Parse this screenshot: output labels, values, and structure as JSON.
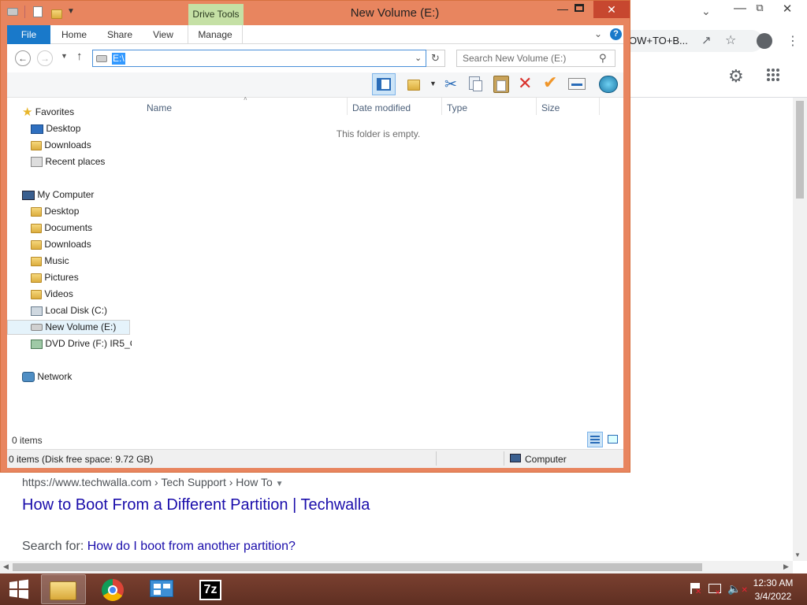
{
  "window": {
    "title": "New Volume (E:)",
    "context_tab": "Drive Tools"
  },
  "ribbon": {
    "tabs": [
      "File",
      "Home",
      "Share",
      "View",
      "Manage"
    ]
  },
  "address": {
    "value": "E:\\",
    "search_placeholder": "Search New Volume (E:)"
  },
  "nav": {
    "favorites": {
      "header": "Favorites",
      "items": [
        "Desktop",
        "Downloads",
        "Recent places"
      ]
    },
    "computer": {
      "header": "My Computer",
      "items": [
        "Desktop",
        "Documents",
        "Downloads",
        "Music",
        "Pictures",
        "Videos",
        "Local Disk (C:)",
        "New Volume (E:)",
        "DVD Drive (F:) IR5_C"
      ]
    },
    "network": "Network",
    "selected": "New Volume (E:)"
  },
  "columns": [
    "Name",
    "Date modified",
    "Type",
    "Size"
  ],
  "empty_message": "This folder is empty.",
  "item_count": "0 items",
  "status": {
    "left": "0 items (Disk free space: 9.72 GB)",
    "right": "Computer"
  },
  "browser": {
    "url_tail": "OW+TO+B...",
    "breadcrumb": "https://www.techwalla.com › Tech Support › How To",
    "result_title": "How to Boot From a Different Partition | Techwalla",
    "search_prefix": "Search for:",
    "search_link": "How do I boot from another partition?"
  },
  "clock": {
    "time": "12:30 AM",
    "date": "3/4/2022"
  },
  "taskbar": {
    "apps": [
      "file-explorer",
      "chrome",
      "control-panel",
      "7zip"
    ],
    "zip_label": "7z"
  },
  "colors": {
    "frame": "#e8855f",
    "taskbar": "#6b3626",
    "accent": "#1979ca",
    "link": "#1a0dab"
  }
}
